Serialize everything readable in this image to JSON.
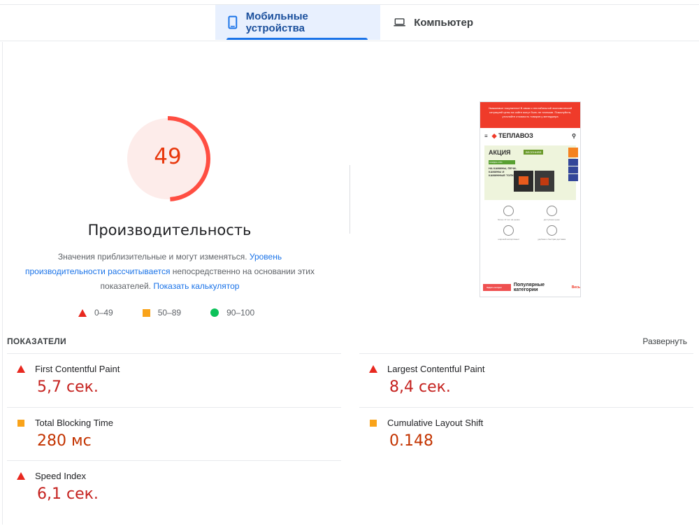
{
  "tabs": [
    {
      "label": "Мобильные устройства",
      "icon": "phone-icon"
    },
    {
      "label": "Компьютер",
      "icon": "laptop-icon"
    }
  ],
  "score": {
    "value": "49",
    "fraction": 0.49,
    "color": "#ff4e42",
    "title": "Производительность",
    "desc_part1": "Значения приблизительные и могут изменяться. ",
    "desc_link1": "Уровень производительности рассчитывается",
    "desc_part2": " непосредственно на основании этих показателей. ",
    "desc_link2": "Показать калькулятор"
  },
  "legend": [
    {
      "label": "0–49",
      "shape": "triangle",
      "color": "#e8281f"
    },
    {
      "label": "50–89",
      "shape": "square",
      "color": "#f9a31a"
    },
    {
      "label": "90–100",
      "shape": "circle",
      "color": "#0cc25a"
    }
  ],
  "metrics": {
    "heading": "ПОКАЗАТЕЛИ",
    "expand": "Развернуть",
    "items": [
      {
        "name": "First Contentful Paint",
        "value": "5,7 сек.",
        "status": "poor"
      },
      {
        "name": "Largest Contentful Paint",
        "value": "8,4 сек.",
        "status": "poor"
      },
      {
        "name": "Total Blocking Time",
        "value": "280 мс",
        "status": "average"
      },
      {
        "name": "Cumulative Layout Shift",
        "value": "0.148",
        "status": "average"
      },
      {
        "name": "Speed Index",
        "value": "6,1 сек.",
        "status": "poor"
      }
    ]
  },
  "preview": {
    "banner": "Уважаемые покупатели! В связи с нестабильной экономической ситуацией цены на сайте могут быть не точными. Пожалуйста, уточняйте стоимость товаров у менеджера",
    "logo": "ТЕПЛАВОЗ",
    "promo_title": "АКЦИЯ",
    "promo_tag": "ВЕСЕННЯЯ",
    "promo_badge": "СКИДКА 15%",
    "promo_lines": "НА КАМИНЫ, ПЕЧИ-КАМИНЫ И КАМИННЫЕ ТОПКИ",
    "features": [
      "более 17 лет на рынке",
      "доступные цены",
      "широкий ассортимент",
      "удобная и быстрая доставка"
    ],
    "bottom_title": "Популярные категории",
    "bottom_all": "Весь",
    "bottom_btn": "Задать вопрос"
  }
}
